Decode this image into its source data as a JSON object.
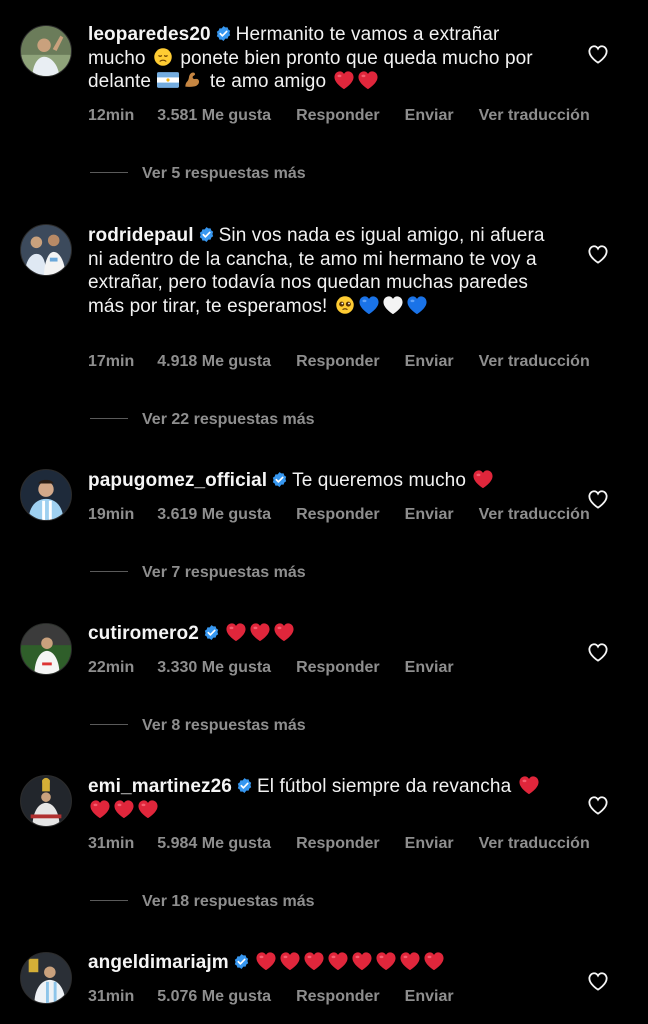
{
  "colors": {
    "background": "#000000",
    "text": "#f2f2f2",
    "secondary": "#8e8e8e",
    "verified": "#3797f0",
    "heart_red": "#e0263b",
    "heart_blue": "#1a73e8",
    "heart_white": "#ffffff"
  },
  "labels": {
    "likes_suffix": "Me gusta",
    "reply": "Responder",
    "send": "Enviar",
    "translate": "Ver traducción"
  },
  "comments": [
    {
      "username": "leoparedes20",
      "text_1": "Hermanito te vamos a extrañar mucho",
      "text_2": "ponete bien pronto que queda mucho por delante",
      "text_3": "te amo amigo",
      "emojis": [
        "disappointed-face",
        "argentina-flag",
        "flexed-biceps",
        "red-heart",
        "red-heart"
      ],
      "time": "12min",
      "likes": "3.581 Me gusta",
      "reply": "Responder",
      "send": "Enviar",
      "translate": "Ver traducción",
      "more_replies": "Ver 5 respuestas más"
    },
    {
      "username": "rodridepaul",
      "text_1": "Sin vos nada es igual amigo, ni afuera ni adentro de la cancha, te amo mi hermano te voy a extrañar, pero todavía nos quedan muchas paredes más por tirar, te esperamos!",
      "emojis": [
        "pleading-face",
        "blue-heart",
        "white-heart",
        "blue-heart"
      ],
      "time": "17min",
      "likes": "4.918 Me gusta",
      "reply": "Responder",
      "send": "Enviar",
      "translate": "Ver traducción",
      "more_replies": "Ver 22 respuestas más"
    },
    {
      "username": "papugomez_official",
      "text_1": "Te queremos mucho",
      "emojis": [
        "red-heart"
      ],
      "time": "19min",
      "likes": "3.619 Me gusta",
      "reply": "Responder",
      "send": "Enviar",
      "translate": "Ver traducción",
      "more_replies": "Ver 7 respuestas más"
    },
    {
      "username": "cutiromero2",
      "text_1": "",
      "emojis": [
        "red-heart",
        "red-heart",
        "red-heart"
      ],
      "time": "22min",
      "likes": "3.330 Me gusta",
      "reply": "Responder",
      "send": "Enviar",
      "more_replies": "Ver 8 respuestas más"
    },
    {
      "username": "emi_martinez26",
      "text_1": "El fútbol siempre da revancha",
      "emojis": [
        "red-heart",
        "red-heart",
        "red-heart",
        "red-heart"
      ],
      "time": "31min",
      "likes": "5.984 Me gusta",
      "reply": "Responder",
      "send": "Enviar",
      "translate": "Ver traducción",
      "more_replies": "Ver 18 respuestas más"
    },
    {
      "username": "angeldimariajm",
      "text_1": "",
      "emojis": [
        "red-heart",
        "red-heart",
        "red-heart",
        "red-heart",
        "red-heart",
        "red-heart",
        "red-heart",
        "red-heart"
      ],
      "time": "31min",
      "likes": "5.076 Me gusta",
      "reply": "Responder",
      "send": "Enviar"
    }
  ]
}
